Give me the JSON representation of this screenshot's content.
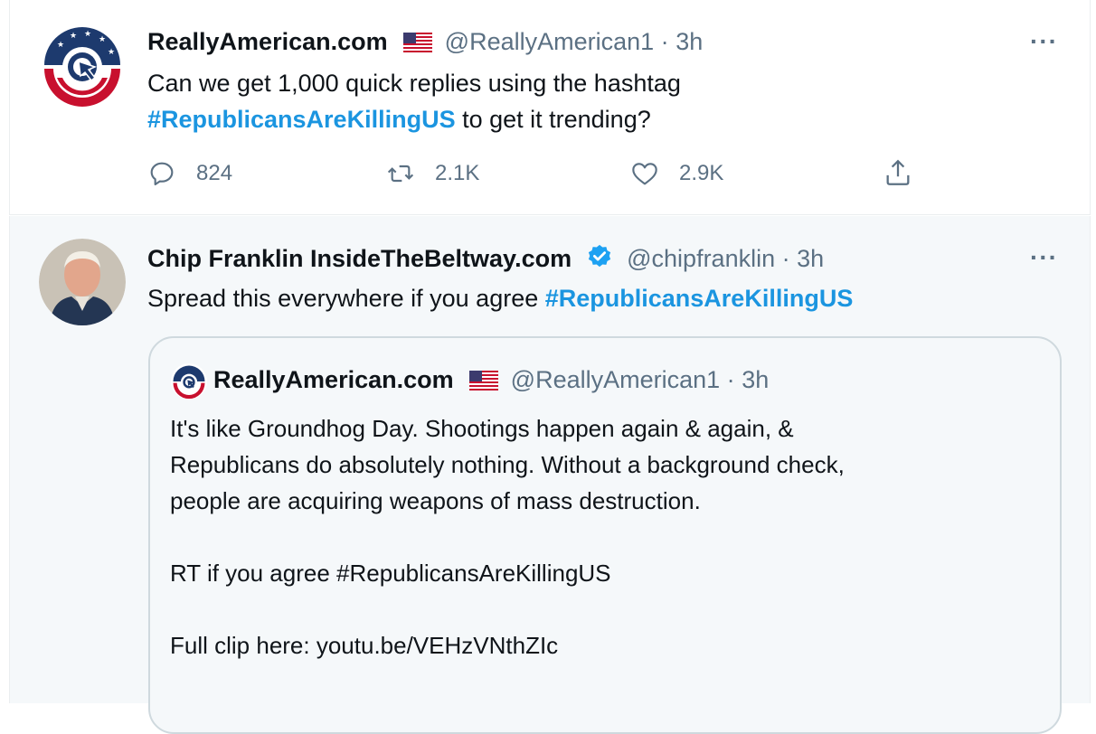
{
  "tweet1": {
    "display_name": "ReallyAmerican.com",
    "handle": "@ReallyAmerican1",
    "separator": "·",
    "time": "3h",
    "text_line1": "Can we get 1,000 quick replies using the hashtag",
    "hashtag": "#RepublicansAreKillingUS",
    "text_line2_rest": " to get it trending?",
    "replies": "824",
    "retweets": "2.1K",
    "likes": "2.9K",
    "more": "···"
  },
  "tweet2": {
    "display_name": "Chip Franklin InsideTheBeltway.com",
    "handle": "@chipfranklin",
    "separator": "·",
    "time": "3h",
    "text": "Spread this everywhere if you agree ",
    "hashtag": "#RepublicansAreKillingUS",
    "more": "···"
  },
  "quote": {
    "display_name": "ReallyAmerican.com",
    "handle": "@ReallyAmerican1",
    "separator": "·",
    "time": "3h",
    "para1_line1": "It's like Groundhog Day. Shootings happen again & again, &",
    "para1_line2": "Republicans do absolutely nothing. Without a background check,",
    "para1_line3": "people are acquiring weapons of mass destruction.",
    "para2": "RT if you agree #RepublicansAreKillingUS",
    "para3": "Full clip here: youtu.be/VEHzVNthZIc"
  },
  "colors": {
    "link_blue": "#1b95e0",
    "secondary_text": "#5b7083",
    "verified_blue": "#1da1f2",
    "quoted_bg": "#f5f8fa",
    "logo_navy": "#1d3a6e",
    "logo_red": "#c8102e"
  },
  "icons": [
    "reply-icon",
    "retweet-icon",
    "like-icon",
    "share-icon",
    "verified-badge-icon",
    "us-flag-icon",
    "more-icon"
  ]
}
